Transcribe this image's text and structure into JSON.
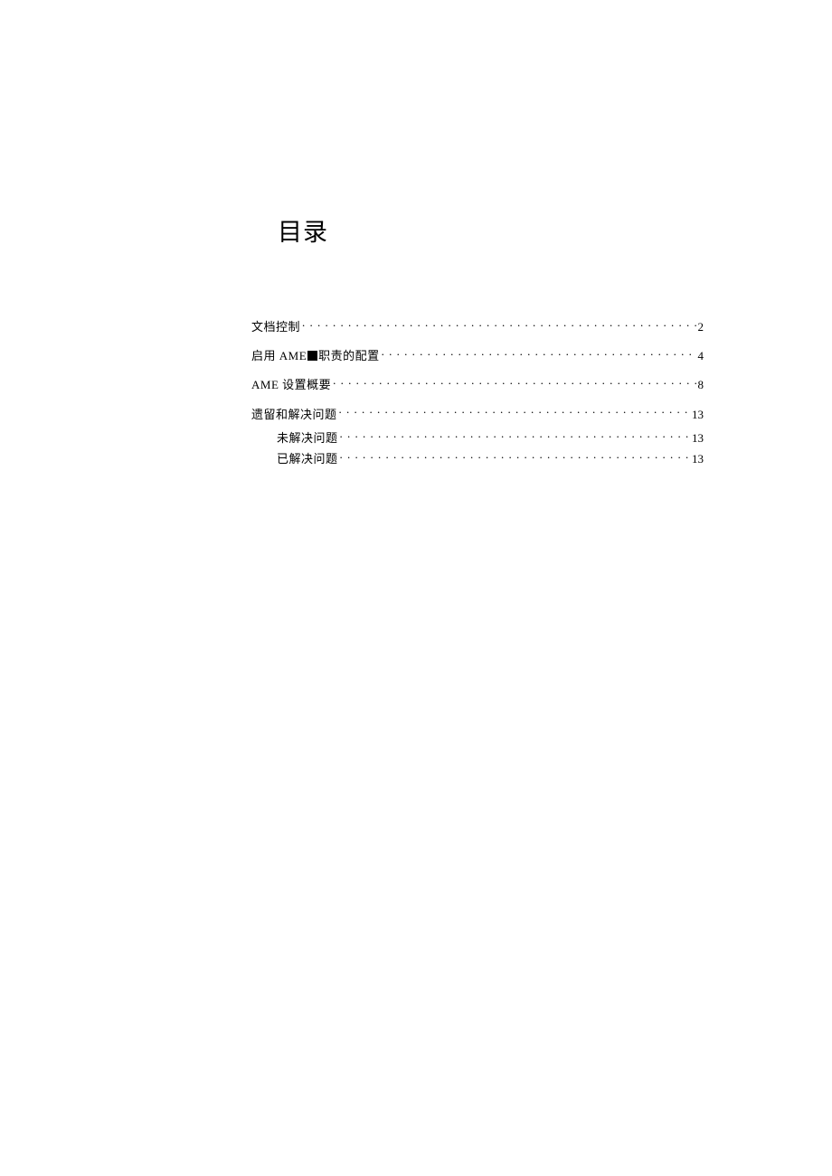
{
  "title": "目录",
  "toc": [
    {
      "label_before": "文档控制",
      "label_after": "",
      "has_square": false,
      "page": "2",
      "level": 0
    },
    {
      "label_before": "启用 AME",
      "label_after": "职责的配置",
      "has_square": true,
      "page": "4",
      "level": 0
    },
    {
      "label_before": "AME 设置概要",
      "label_after": "",
      "has_square": false,
      "page": "8",
      "level": 0
    },
    {
      "label_before": "遗留和解决问题",
      "label_after": "",
      "has_square": false,
      "page": "13",
      "level": 0
    },
    {
      "label_before": "未解决问题",
      "label_after": "",
      "has_square": false,
      "page": "13",
      "level": 1
    },
    {
      "label_before": "已解决问题",
      "label_after": "",
      "has_square": false,
      "page": "13",
      "level": 1
    }
  ]
}
